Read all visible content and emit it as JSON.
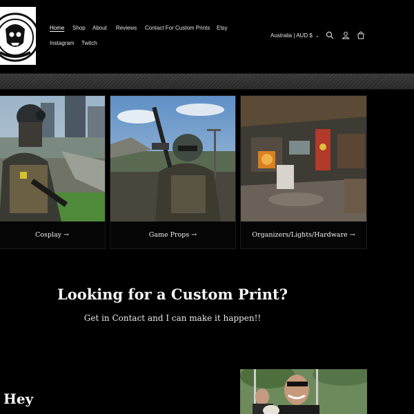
{
  "header": {
    "logo_alt": "logo",
    "nav": [
      {
        "label": "Home",
        "active": true
      },
      {
        "label": "Shop"
      },
      {
        "label": "About"
      },
      {
        "label": "Reviews"
      },
      {
        "label": "Contact For Custom Prints"
      },
      {
        "label": "Etsy"
      },
      {
        "label": "Instagram"
      },
      {
        "label": "Twitch"
      }
    ],
    "locale": "Australia | AUD $",
    "icons": [
      "search-icon",
      "account-icon",
      "cart-icon"
    ]
  },
  "collections": [
    {
      "label": "Cosplay →"
    },
    {
      "label": "Game Props →"
    },
    {
      "label": "Organizers/Lights/Hardware →"
    }
  ],
  "cta": {
    "title": "Looking for a Custom Print?",
    "subtitle": "Get in Contact and I can make it happen!!"
  },
  "about": {
    "heading": "Hey"
  },
  "colors": {
    "background": "#000000",
    "text": "#ffffff",
    "band": "#333333"
  }
}
